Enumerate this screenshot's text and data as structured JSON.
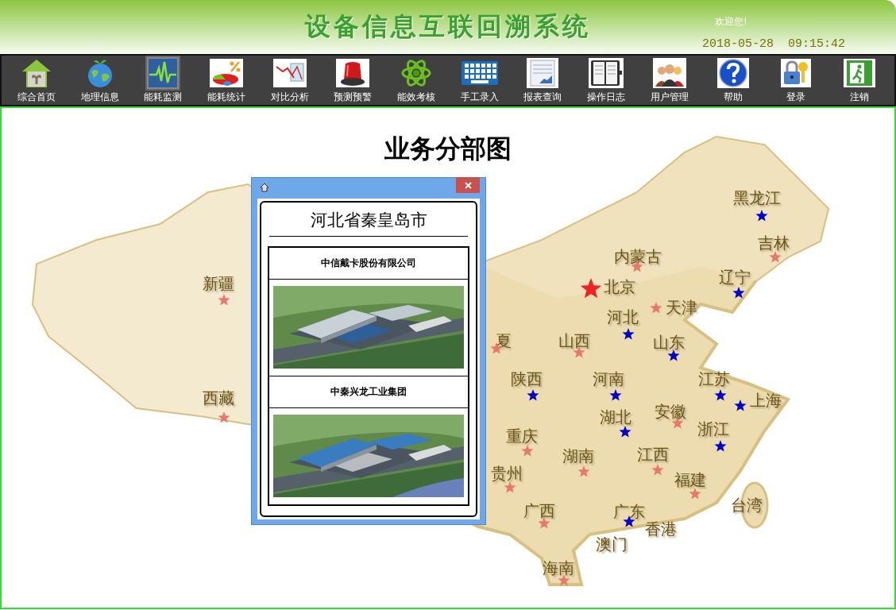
{
  "header": {
    "title": "设备信息互联回溯系统",
    "welcome": "欢迎您!",
    "datetime": "2018-05-28  09:15:42"
  },
  "toolbar": [
    {
      "label": "综合首页",
      "selected": false
    },
    {
      "label": "地理信息",
      "selected": false
    },
    {
      "label": "能耗监测",
      "selected": true
    },
    {
      "label": "能耗统计",
      "selected": false
    },
    {
      "label": "对比分析",
      "selected": false
    },
    {
      "label": "预测预警",
      "selected": false
    },
    {
      "label": "能效考核",
      "selected": false
    },
    {
      "label": "手工录入",
      "selected": false
    },
    {
      "label": "报表查询",
      "selected": false
    },
    {
      "label": "操作日志",
      "selected": false
    },
    {
      "label": "用户管理",
      "selected": false
    },
    {
      "label": "帮助",
      "selected": false
    },
    {
      "label": "登录",
      "selected": false
    },
    {
      "label": "注销",
      "selected": false
    }
  ],
  "main": {
    "title": "业务分部图",
    "provinces": [
      {
        "name": "黑龙江",
        "kind": "province",
        "color": "#0000cc"
      },
      {
        "name": "吉林",
        "kind": "province",
        "color": "#e8786c"
      },
      {
        "name": "内蒙古",
        "kind": "province",
        "color": "#e8786c"
      },
      {
        "name": "新疆",
        "kind": "province",
        "color": "#e8786c"
      },
      {
        "name": "北京",
        "kind": "capital",
        "color": "#ee2222"
      },
      {
        "name": "辽宁",
        "kind": "province",
        "color": "#0000cc"
      },
      {
        "name": "天津",
        "kind": "province",
        "color": "#e8786c"
      },
      {
        "name": "河北",
        "kind": "province",
        "color": "#0000cc"
      },
      {
        "name": "夏",
        "kind": "province",
        "color": "#e8786c"
      },
      {
        "name": "山西",
        "kind": "province",
        "color": "#e8786c"
      },
      {
        "name": "山东",
        "kind": "province",
        "color": "#0000cc"
      },
      {
        "name": "陕西",
        "kind": "province",
        "color": "#0000cc"
      },
      {
        "name": "河南",
        "kind": "province",
        "color": "#0000cc"
      },
      {
        "name": "江苏",
        "kind": "province",
        "color": "#0000cc"
      },
      {
        "name": "西藏",
        "kind": "province",
        "color": "#e8786c"
      },
      {
        "name": "上海",
        "kind": "province",
        "color": "#0000cc"
      },
      {
        "name": "湖北",
        "kind": "province",
        "color": "#0000cc"
      },
      {
        "name": "安徽",
        "kind": "province",
        "color": "#e8786c"
      },
      {
        "name": "重庆",
        "kind": "province",
        "color": "#e8786c"
      },
      {
        "name": "浙江",
        "kind": "province",
        "color": "#0000cc"
      },
      {
        "name": "湖南",
        "kind": "province",
        "color": "#e8786c"
      },
      {
        "name": "江西",
        "kind": "province",
        "color": "#e8786c"
      },
      {
        "name": "贵州",
        "kind": "province",
        "color": "#e8786c"
      },
      {
        "name": "福建",
        "kind": "province",
        "color": "#e8786c"
      },
      {
        "name": "广西",
        "kind": "province",
        "color": "#e8786c"
      },
      {
        "name": "广东",
        "kind": "province",
        "color": "#0000cc"
      },
      {
        "name": "台湾",
        "kind": "province"
      },
      {
        "name": "香港",
        "kind": "province"
      },
      {
        "name": "澳门",
        "kind": "province"
      },
      {
        "name": "海南",
        "kind": "province",
        "color": "#e8786c"
      }
    ]
  },
  "popup": {
    "region": "河北省秦皇岛市",
    "companies": [
      {
        "name": "中信戴卡股份有限公司"
      },
      {
        "name": "中秦兴龙工业集团"
      }
    ]
  }
}
